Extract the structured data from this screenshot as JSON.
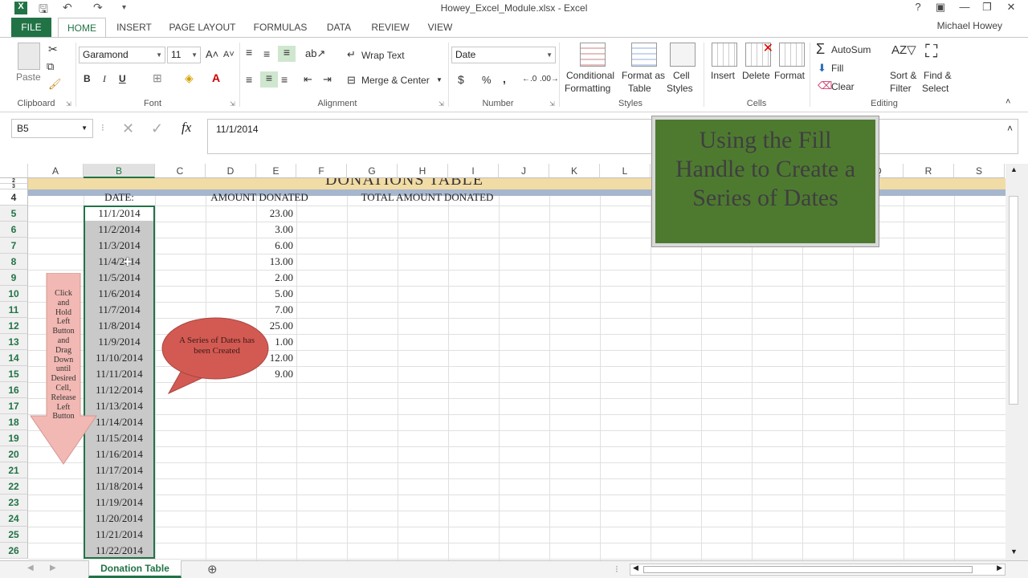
{
  "window": {
    "title": "Howey_Excel_Module.xlsx - Excel",
    "user": "Michael Howey",
    "buttons": [
      "?",
      "▣",
      "—",
      "❐",
      "✕"
    ]
  },
  "tabs": [
    "FILE",
    "HOME",
    "INSERT",
    "PAGE LAYOUT",
    "FORMULAS",
    "DATA",
    "REVIEW",
    "VIEW"
  ],
  "ribbon": {
    "clipboard": {
      "paste": "Paste",
      "label": "Clipboard"
    },
    "font": {
      "name": "Garamond",
      "size": "11",
      "bold": "B",
      "italic": "I",
      "underline": "U",
      "label": "Font"
    },
    "alignment": {
      "wrap": "Wrap Text",
      "merge": "Merge & Center",
      "label": "Alignment"
    },
    "number": {
      "format": "Date",
      "currency": "$",
      "percent": "%",
      "comma": ",",
      "label": "Number"
    },
    "styles": {
      "conditional1": "Conditional",
      "conditional2": "Formatting",
      "table1": "Format as",
      "table2": "Table",
      "cell1": "Cell",
      "cell2": "Styles",
      "label": "Styles"
    },
    "cells": {
      "insert": "Insert",
      "delete": "Delete",
      "format": "Format",
      "label": "Cells"
    },
    "editing": {
      "autosum": "AutoSum",
      "fill": "Fill",
      "clear": "Clear",
      "sort1": "Sort &",
      "sort2": "Filter",
      "find1": "Find &",
      "find2": "Select",
      "label": "Editing"
    }
  },
  "formula": {
    "namebox": "B5",
    "fx": "fx",
    "value": "11/1/2014"
  },
  "columns": [
    "A",
    "B",
    "C",
    "D",
    "E",
    "F",
    "G",
    "H",
    "I",
    "J",
    "K",
    "L",
    "M",
    "N",
    "O",
    "P",
    "Q",
    "R",
    "S"
  ],
  "rows": [
    "2",
    "3",
    "4",
    "5",
    "6",
    "7",
    "8",
    "9",
    "10",
    "11",
    "12",
    "13",
    "14",
    "15",
    "16",
    "17",
    "18",
    "19",
    "20",
    "21",
    "22",
    "23",
    "24",
    "25",
    "26"
  ],
  "sheet": {
    "banner": "DONATIONS TABLE",
    "header_date": "DATE:",
    "header_amount": "AMOUNT DONATED",
    "header_total": "TOTAL AMOUNT DONATED",
    "dates": [
      "11/1/2014",
      "11/2/2014",
      "11/3/2014",
      "11/4/2014",
      "11/5/2014",
      "11/6/2014",
      "11/7/2014",
      "11/8/2014",
      "11/9/2014",
      "11/10/2014",
      "11/11/2014",
      "11/12/2014",
      "11/13/2014",
      "11/14/2014",
      "11/15/2014",
      "11/16/2014",
      "11/17/2014",
      "11/18/2014",
      "11/19/2014",
      "11/20/2014",
      "11/21/2014",
      "11/22/2014"
    ],
    "amounts": [
      "23.00",
      "3.00",
      "6.00",
      "13.00",
      "2.00",
      "5.00",
      "7.00",
      "25.00",
      "1.00",
      "12.00",
      "9.00"
    ]
  },
  "callouts": {
    "title_box": "Using the Fill Handle to Create a Series of Dates",
    "arrow_text": [
      "Click",
      "and",
      "Hold",
      "Left",
      "Button",
      "and",
      "Drag",
      "Down",
      "until",
      "Desired",
      "Cell,",
      "Release",
      "Left",
      "Button"
    ],
    "bubble": "A Series of Dates has been Created"
  },
  "sheet_tab": "Donation Table",
  "colors": {
    "excel_green": "#217346",
    "title_box": "#4e7a30",
    "banner": "#f2dca5",
    "band": "#a6b6cd",
    "arrow": "#f2b8b3",
    "bubble": "#d35a52"
  }
}
